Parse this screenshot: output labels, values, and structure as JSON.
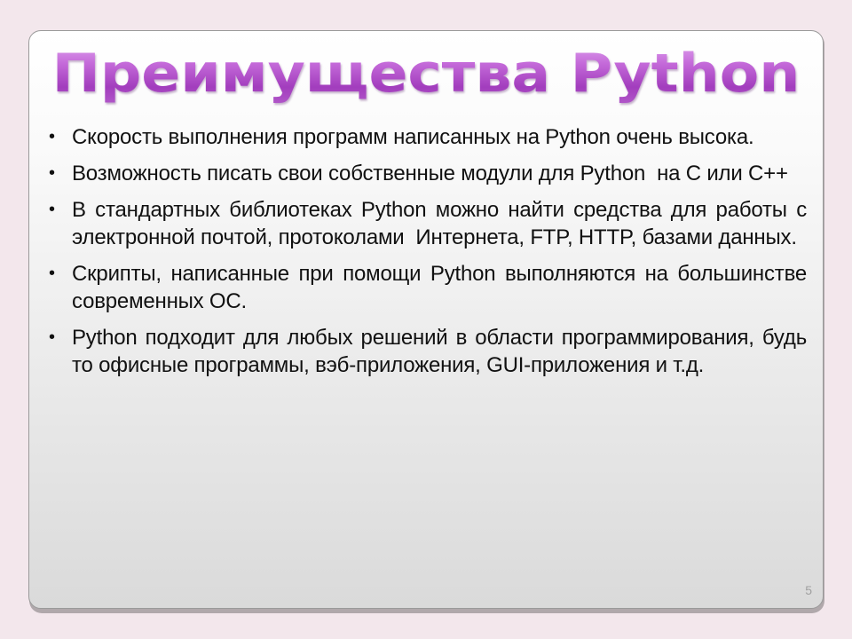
{
  "slide": {
    "title": "Преимущества Python",
    "bullets": [
      {
        "marker": "•",
        "text": "Скорость выполнения программ написанных на Python очень высока."
      },
      {
        "marker": "•",
        "text": "Возможность писать свои собственные модули для Python  на C или C++"
      },
      {
        "marker": "•",
        "text": "В стандартных библиотеках Python можно найти средства для работы с электронной почтой, протоколами  Интернета, FTP, HTTP, базами данных."
      },
      {
        "marker": "•",
        "text": "Скрипты, написанные при помощи Python выполняются на большинстве современных ОС."
      },
      {
        "marker": "•",
        "text": "Python подходит для любых решений в области программирования, будь то офисные программы, вэб-приложения, GUI-приложения и т.д."
      }
    ],
    "page_number": "5"
  },
  "colors": {
    "background": "#f3e7ec",
    "title_accent": "#b14fc9",
    "text": "#111111",
    "page_number": "#a0a0a0"
  }
}
